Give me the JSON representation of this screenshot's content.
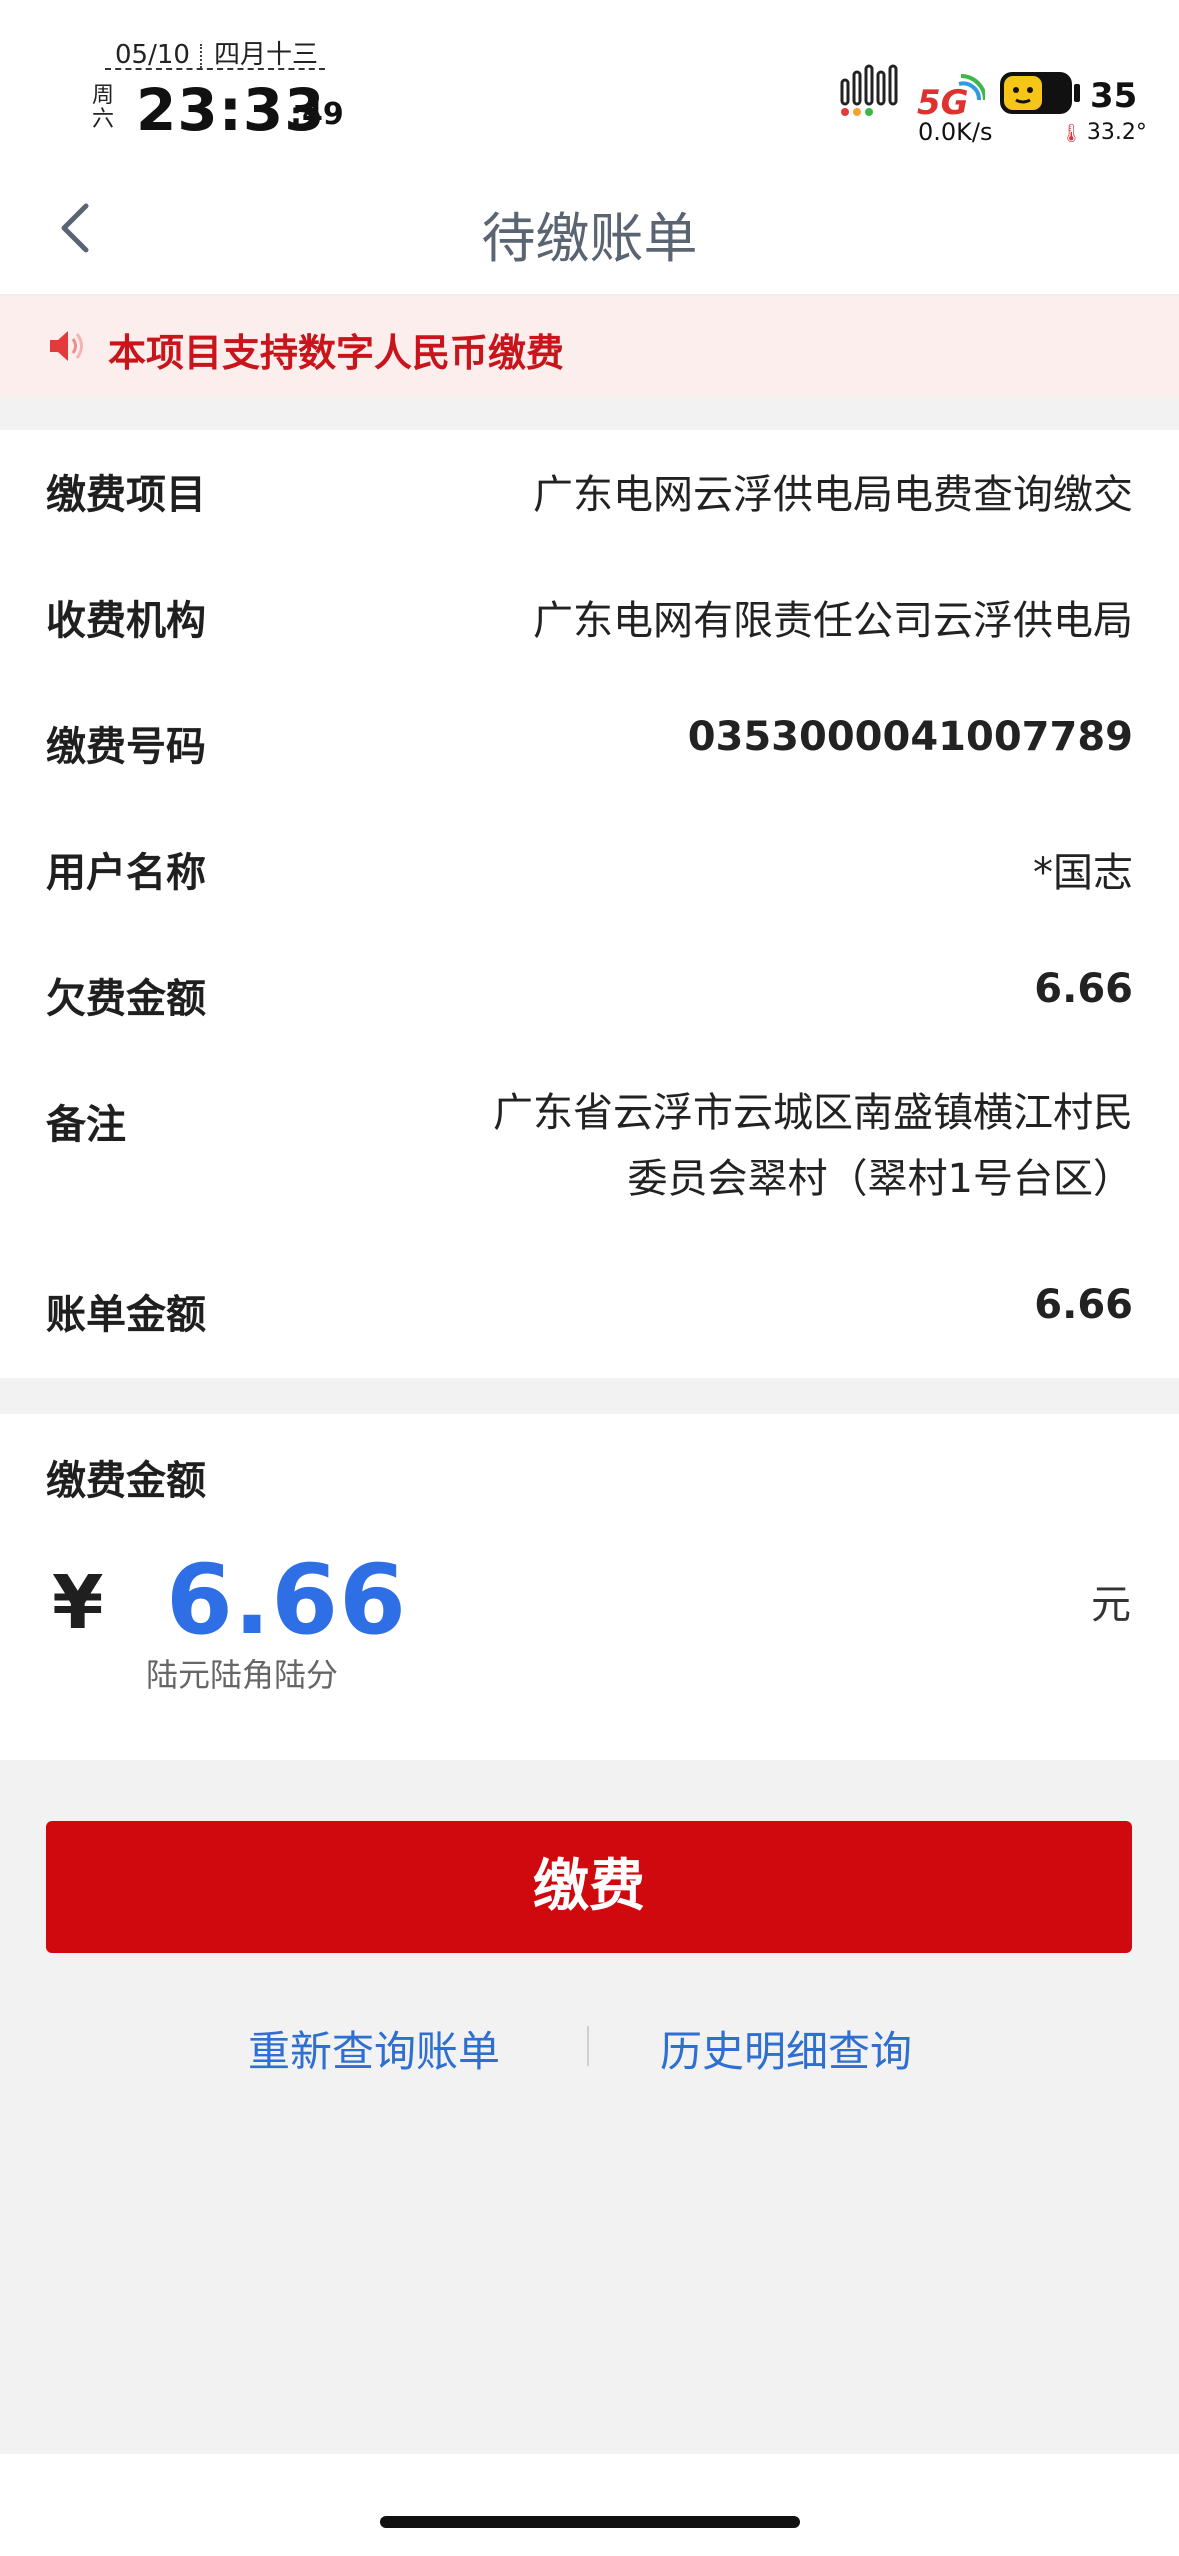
{
  "status_bar": {
    "date": "05/10",
    "lunar": "四月十三",
    "weekday": "周六",
    "time": "23:33",
    "seconds": ":49",
    "net_type": "5G",
    "net_speed": "0.0K/s",
    "battery_level": "35",
    "temperature": "33.2°"
  },
  "nav": {
    "back_icon": "chevron-left-icon",
    "title": "待缴账单"
  },
  "notice": {
    "icon": "speaker-icon",
    "text": "本项目支持数字人民币缴费",
    "color": "#c8141a"
  },
  "bill": {
    "rows": [
      {
        "label": "缴费项目",
        "value": "广东电网云浮供电局电费查询缴交"
      },
      {
        "label": "收费机构",
        "value": "广东电网有限责任公司云浮供电局"
      },
      {
        "label": "缴费号码",
        "value": "0353000041007789"
      },
      {
        "label": "用户名称",
        "value": "*国志"
      },
      {
        "label": "欠费金额",
        "value": "6.66"
      },
      {
        "label": "备注",
        "value_line1": "广东省云浮市云城区南盛镇横江村民",
        "value_line2": "委员会翠村（翠村1号台区）"
      },
      {
        "label": "账单金额",
        "value": "6.66"
      }
    ]
  },
  "payment": {
    "title": "缴费金额",
    "currency_symbol": "¥",
    "amount": "6.66",
    "unit": "元",
    "amount_in_words": "陆元陆角陆分",
    "amount_color": "#2f6fe6"
  },
  "actions": {
    "pay_label": "缴费",
    "pay_color": "#d0090f",
    "requery_label": "重新查询账单",
    "history_label": "历史明细查询"
  }
}
